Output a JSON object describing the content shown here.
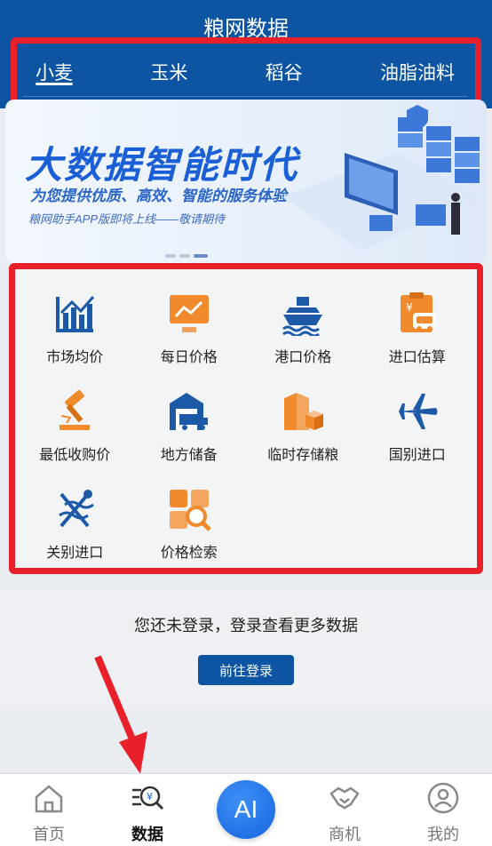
{
  "header": {
    "title": "粮网数据"
  },
  "tabs": [
    {
      "label": "小麦",
      "active": true
    },
    {
      "label": "玉米",
      "active": false
    },
    {
      "label": "稻谷",
      "active": false
    },
    {
      "label": "油脂油料",
      "active": false
    }
  ],
  "banner": {
    "headline": "大数据智能时代",
    "subtitle": "为您提供优质、高效、智能的服务体验",
    "note": "粮网助手APP版即将上线——敬请期待"
  },
  "grid": [
    {
      "label": "市场均价",
      "icon": "bar-chart-icon",
      "color": "#1c5aa8"
    },
    {
      "label": "每日价格",
      "icon": "monitor-chart-icon",
      "color": "#f08a2c"
    },
    {
      "label": "港口价格",
      "icon": "ship-icon",
      "color": "#1c5aa8"
    },
    {
      "label": "进口估算",
      "icon": "calculator-icon",
      "color": "#f08a2c"
    },
    {
      "label": "最低收购价",
      "icon": "gavel-icon",
      "color": "#f08a2c"
    },
    {
      "label": "地方储备",
      "icon": "warehouse-truck-icon",
      "color": "#1c5aa8"
    },
    {
      "label": "临时存储粮",
      "icon": "storage-box-icon",
      "color": "#f08a2c"
    },
    {
      "label": "国别进口",
      "icon": "airplane-icon",
      "color": "#1c5aa8"
    },
    {
      "label": "关别进口",
      "icon": "caduceus-icon",
      "color": "#1c5aa8"
    },
    {
      "label": "价格检索",
      "icon": "search-grid-icon",
      "color": "#f08a2c"
    }
  ],
  "login": {
    "prompt": "您还未登录，登录查看更多数据",
    "button": "前往登录"
  },
  "bottom_nav": [
    {
      "label": "首页",
      "icon": "home-icon"
    },
    {
      "label": "数据",
      "icon": "data-search-icon",
      "active": true
    },
    {
      "label": "AI",
      "icon": "ai-icon"
    },
    {
      "label": "商机",
      "icon": "handshake-icon"
    },
    {
      "label": "我的",
      "icon": "user-icon"
    }
  ],
  "colors": {
    "brand": "#0d55a3",
    "accent": "#f08a2c",
    "annotation": "#e8202a"
  }
}
